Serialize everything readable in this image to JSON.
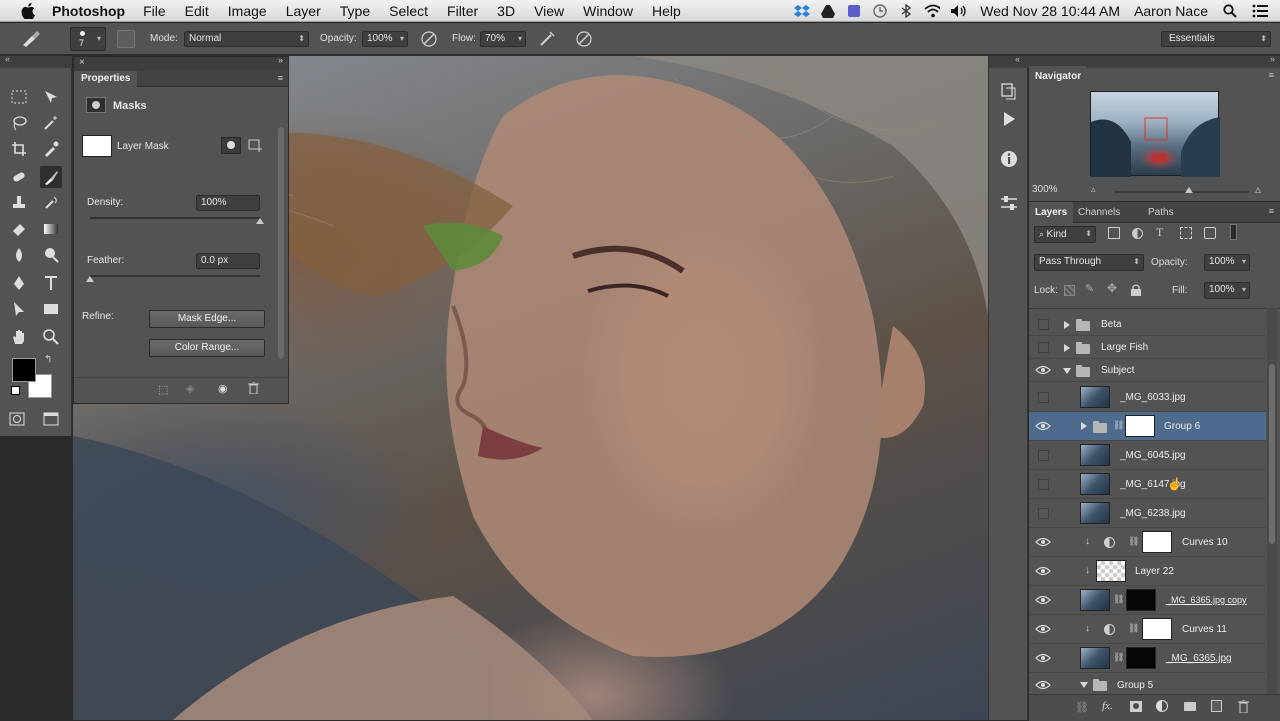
{
  "menubar": {
    "app_name": "Photoshop",
    "items": [
      "File",
      "Edit",
      "Image",
      "Layer",
      "Type",
      "Select",
      "Filter",
      "3D",
      "View",
      "Window",
      "Help"
    ],
    "clock": "Wed Nov 28  10:44 AM",
    "user": "Aaron Nace"
  },
  "options_bar": {
    "brush_size": "7",
    "mode_label": "Mode:",
    "mode_value": "Normal",
    "opacity_label": "Opacity:",
    "opacity_value": "100%",
    "flow_label": "Flow:",
    "flow_value": "70%",
    "workspace": "Essentials"
  },
  "properties": {
    "title": "Properties",
    "section": "Masks",
    "mask_type": "Layer Mask",
    "density_label": "Density:",
    "density_value": "100%",
    "density_level": 1.0,
    "feather_label": "Feather:",
    "feather_value": "0.0 px",
    "feather_level": 0.0,
    "refine_label": "Refine:",
    "mask_edge_button": "Mask Edge...",
    "color_range_button": "Color Range..."
  },
  "navigator": {
    "tab": "Navigator",
    "zoom": "300%"
  },
  "layers_panel": {
    "tabs": [
      "Layers",
      "Channels",
      "Paths"
    ],
    "filter_kind": "Kind",
    "blend_mode": "Pass Through",
    "opacity_label": "Opacity:",
    "opacity_value": "100%",
    "lock_label": "Lock:",
    "fill_label": "Fill:",
    "fill_value": "100%",
    "layers": [
      {
        "name": "Beta"
      },
      {
        "name": "Large Fish"
      },
      {
        "name": "Subject"
      },
      {
        "name": "_MG_6033.jpg"
      },
      {
        "name": "Group 6"
      },
      {
        "name": "_MG_6045.jpg"
      },
      {
        "name": "_MG_6147.jpg"
      },
      {
        "name": "_MG_6238.jpg"
      },
      {
        "name": "Curves 10"
      },
      {
        "name": "Layer 22"
      },
      {
        "name": "_MG_6365.jpg copy"
      },
      {
        "name": "Curves 11"
      },
      {
        "name": "_MG_6365.jpg"
      },
      {
        "name": "Group 5"
      }
    ]
  },
  "colors": {
    "panel_bg": "#535353",
    "selected_layer": "#4e6a8c",
    "foreground": "#000000",
    "background": "#ffffff"
  }
}
